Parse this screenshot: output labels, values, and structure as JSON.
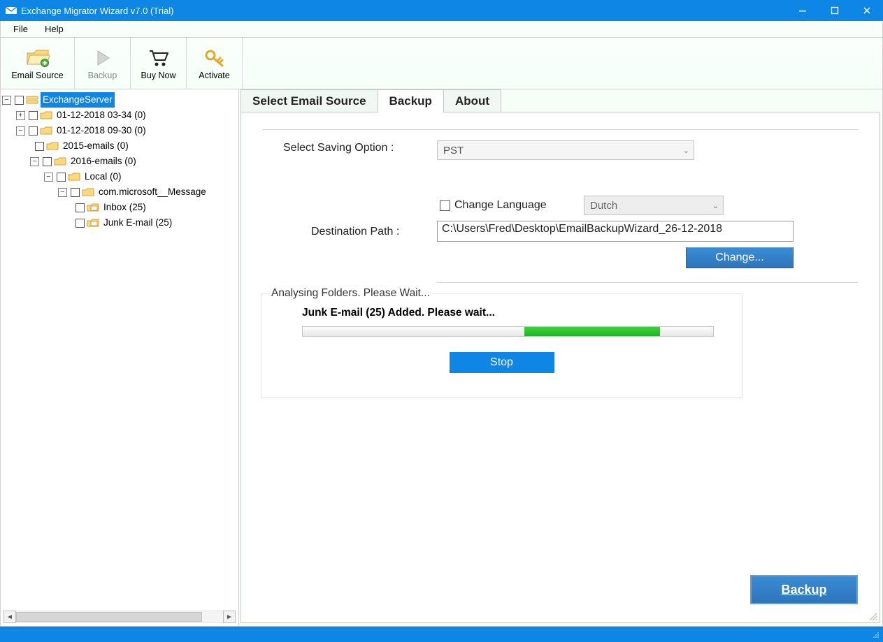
{
  "window": {
    "title": "Exchange Migrator Wizard v7.0 (Trial)"
  },
  "menu": {
    "file": "File",
    "help": "Help"
  },
  "toolbar": {
    "email_source": "Email Source",
    "backup": "Backup",
    "buy_now": "Buy Now",
    "activate": "Activate"
  },
  "tree": {
    "root": "ExchangeServer",
    "n1": "01-12-2018 03-34 (0)",
    "n2": "01-12-2018 09-30 (0)",
    "n3": "2015-emails (0)",
    "n4": "2016-emails (0)",
    "n5": "Local (0)",
    "n6": "com.microsoft__Message",
    "n7": "Inbox (25)",
    "n8": "Junk E-mail (25)"
  },
  "tabs": {
    "select": "Select Email Source",
    "backup": "Backup",
    "about": "About"
  },
  "form": {
    "saving_label": "Select Saving Option  :",
    "saving_value": "PST",
    "change_lang_label": "Change Language",
    "lang_value": "Dutch",
    "dest_label": "Destination Path  :",
    "dest_value": "C:\\Users\\Fred\\Desktop\\EmailBackupWizard_26-12-2018",
    "change_btn": "Change..."
  },
  "progress": {
    "legend": "Analysing Folders. Please Wait...",
    "msg": "Junk E-mail (25) Added. Please wait...",
    "percent": 33,
    "fill_left_pct": 54,
    "stop": "Stop"
  },
  "footer": {
    "backup": "Backup"
  }
}
